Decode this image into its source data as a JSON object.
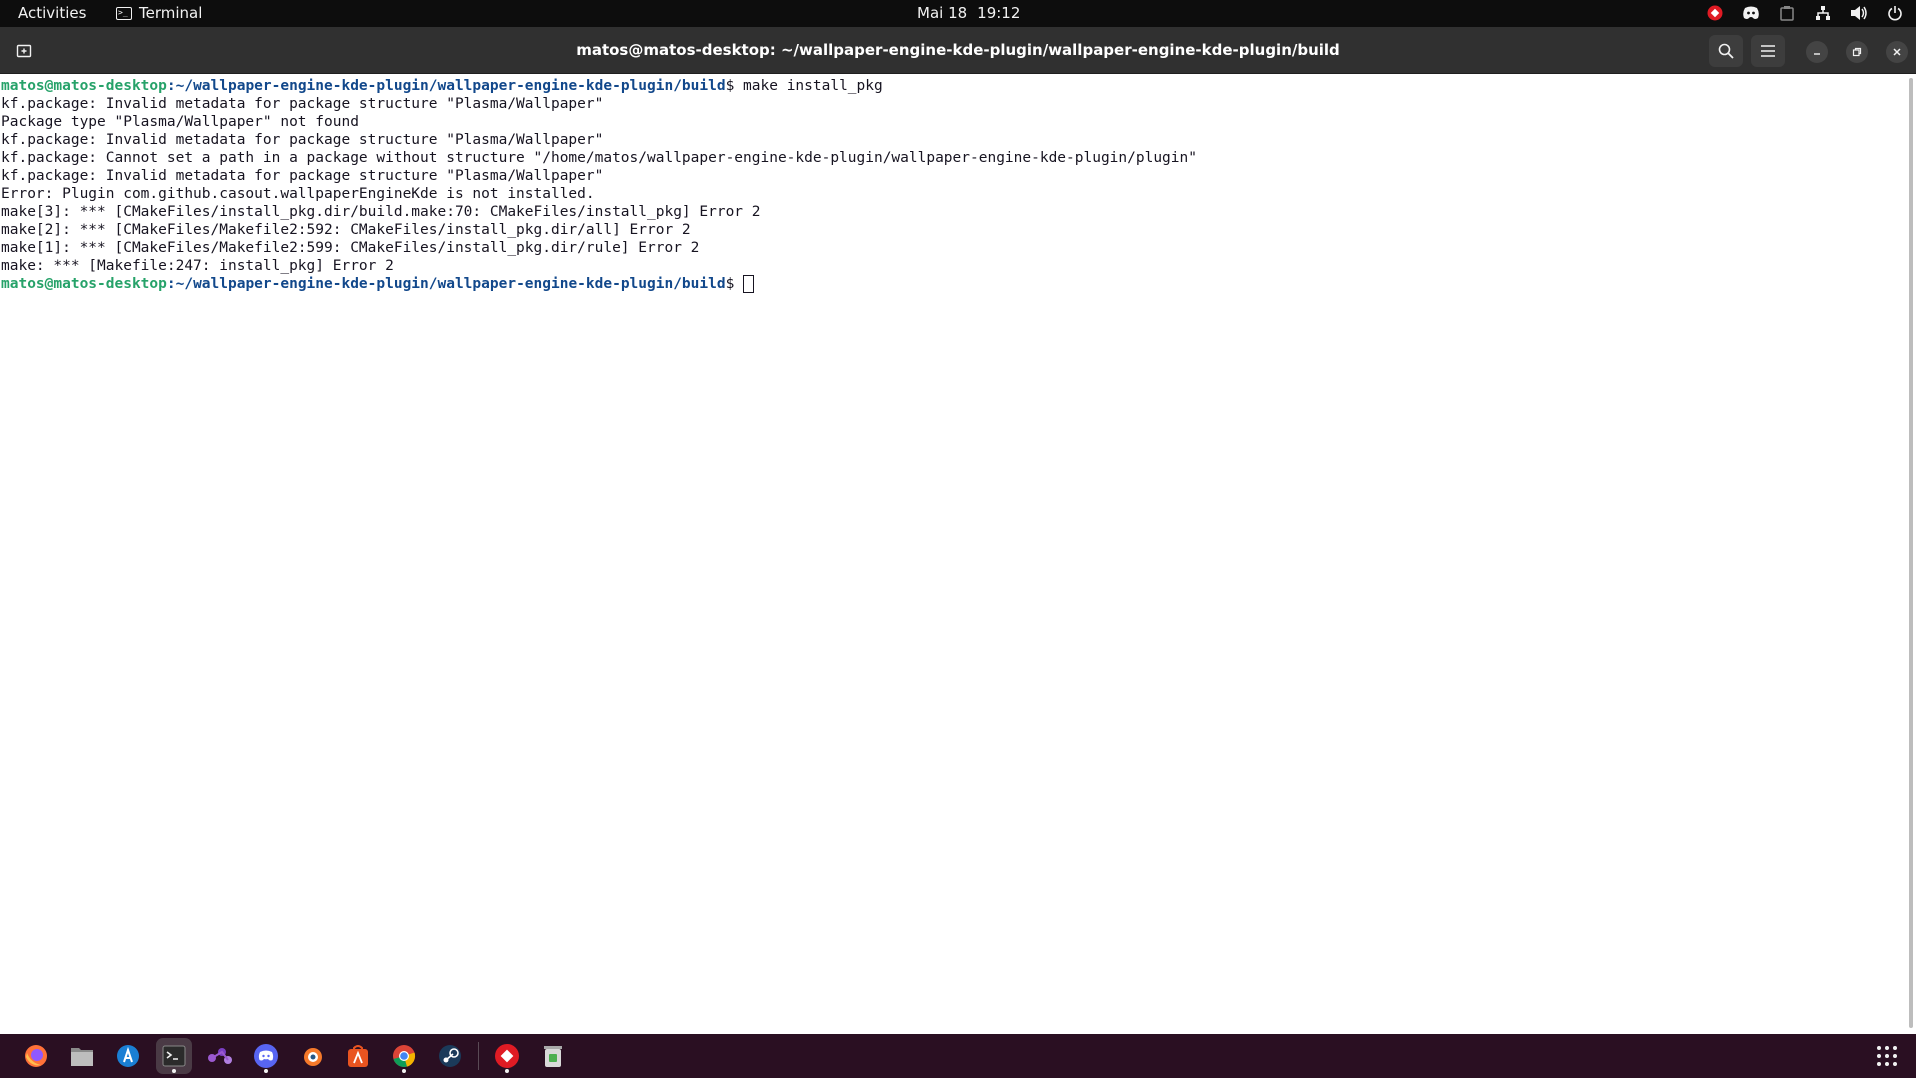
{
  "topbar": {
    "activities": "Activities",
    "app_name": "Terminal",
    "date": "Mai 18",
    "time": "19:12",
    "tray_icons": [
      "anydesk-icon",
      "discord-icon",
      "clipboard-icon",
      "network-icon",
      "volume-icon",
      "power-icon"
    ]
  },
  "window": {
    "title": "matos@matos-desktop: ~/wallpaper-engine-kde-plugin/wallpaper-engine-kde-plugin/build",
    "buttons": [
      "new-tab-icon",
      "search-icon",
      "hamburger-menu-icon",
      "minimize-icon",
      "restore-icon",
      "close-icon"
    ]
  },
  "terminal": {
    "prompt_user": "matos@matos-desktop",
    "prompt_path": ":~/wallpaper-engine-kde-plugin/wallpaper-engine-kde-plugin/build",
    "prompt_suffix": "$ ",
    "command": "make install_pkg",
    "output": [
      "kf.package: Invalid metadata for package structure \"Plasma/Wallpaper\"",
      "Package type \"Plasma/Wallpaper\" not found",
      "kf.package: Invalid metadata for package structure \"Plasma/Wallpaper\"",
      "kf.package: Cannot set a path in a package without structure \"/home/matos/wallpaper-engine-kde-plugin/wallpaper-engine-kde-plugin/plugin\"",
      "kf.package: Invalid metadata for package structure \"Plasma/Wallpaper\"",
      "Error: Plugin com.github.casout.wallpaperEngineKde is not installed.",
      "make[3]: *** [CMakeFiles/install_pkg.dir/build.make:70: CMakeFiles/install_pkg] Error 2",
      "make[2]: *** [CMakeFiles/Makefile2:592: CMakeFiles/install_pkg.dir/all] Error 2",
      "make[1]: *** [CMakeFiles/Makefile2:599: CMakeFiles/install_pkg.dir/rule] Error 2",
      "make: *** [Makefile:247: install_pkg] Error 2"
    ]
  },
  "dock": {
    "apps": [
      "firefox-icon",
      "files-icon",
      "app-store-icon",
      "terminal-icon",
      "kdeconnect-icon",
      "discord-icon",
      "blender-icon",
      "software-center-icon",
      "chrome-icon",
      "steam-icon",
      "anydesk-icon",
      "trash-icon"
    ],
    "show_apps": "show-applications-icon"
  },
  "colors": {
    "prompt_user": "#26a269",
    "prompt_path": "#12488b",
    "terminal_bg": "#ffffff",
    "dock_bg": "#2a0f22"
  }
}
